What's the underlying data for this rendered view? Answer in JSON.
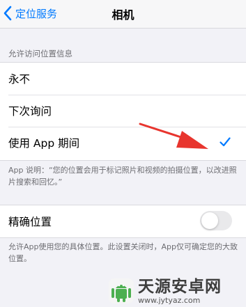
{
  "nav": {
    "back_label": "定位服务",
    "title": "相机"
  },
  "location_access": {
    "header": "允许访问位置信息",
    "options": [
      {
        "label": "永不",
        "selected": false
      },
      {
        "label": "下次询问",
        "selected": false
      },
      {
        "label": "使用 App 期间",
        "selected": true
      }
    ],
    "footer": "App 说明：“您的位置会用于标记照片和视频的拍摄位置，以改进照片搜索和回忆。”"
  },
  "precise_location": {
    "label": "精确位置",
    "enabled": false,
    "footer": "允许App使用您的具体位置。此设置关闭时，App仅可确定您的大致位置。"
  },
  "watermark": {
    "name": "天源安卓网",
    "url": "www.jytyaz.com"
  },
  "colors": {
    "accent": "#007aff",
    "annotation_arrow": "#e8352e",
    "background": "#f2f2f7"
  },
  "icons": {
    "back": "chevron-left-icon",
    "selected": "checkmark-icon",
    "annotation": "red-arrow-icon",
    "logo": "android-logo-icon"
  }
}
